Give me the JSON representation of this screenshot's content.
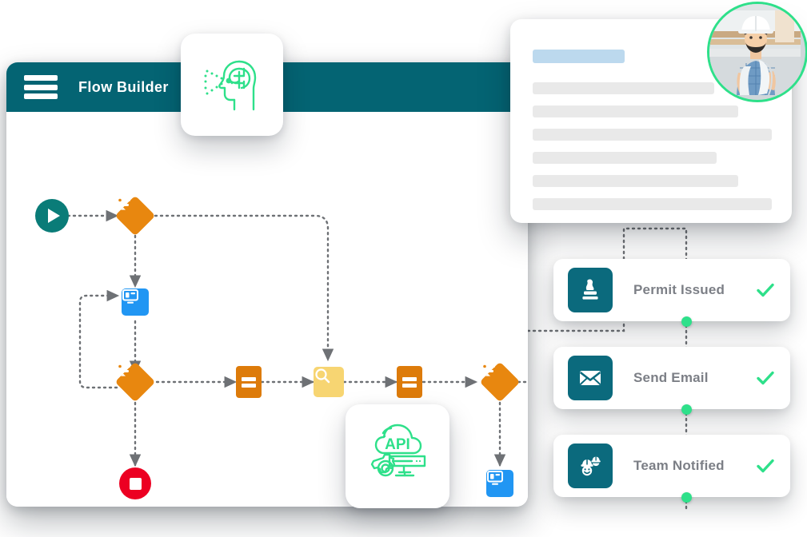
{
  "builder": {
    "title": "Flow Builder",
    "menu_icon": "hamburger-menu-icon",
    "nodes": [
      {
        "id": "start",
        "type": "start-node",
        "icon": "play-icon",
        "color": "#0a7c78"
      },
      {
        "id": "decision-1",
        "type": "decision-node",
        "icon": "filter-diamond-icon",
        "color": "#e8870f"
      },
      {
        "id": "screen-1",
        "type": "screen-node",
        "icon": "form-screen-icon",
        "color": "#2196f3"
      },
      {
        "id": "decision-2",
        "type": "decision-node",
        "icon": "filter-diamond-icon",
        "color": "#e8870f"
      },
      {
        "id": "stop",
        "type": "stop-node",
        "icon": "stop-icon",
        "color": "#ec0022"
      },
      {
        "id": "assign-1",
        "type": "assignment-node",
        "icon": "equals-icon",
        "color": "#dd7b0a"
      },
      {
        "id": "lookup",
        "type": "lookup-node",
        "icon": "search-icon",
        "color": "#f7d572"
      },
      {
        "id": "assign-2",
        "type": "assignment-node",
        "icon": "equals-icon",
        "color": "#dd7b0a"
      },
      {
        "id": "decision-3",
        "type": "decision-node",
        "icon": "filter-diamond-icon",
        "color": "#e8870f"
      },
      {
        "id": "screen-2",
        "type": "screen-node",
        "icon": "form-screen-icon",
        "color": "#2196f3"
      }
    ]
  },
  "floating_cards": [
    {
      "id": "ai-card",
      "icon": "ai-brain-head-icon",
      "color": "#2ee08a"
    },
    {
      "id": "api-card",
      "icon": "api-cloud-gear-icon",
      "color": "#2ee08a"
    }
  ],
  "document_card": {
    "skeleton_lines": [
      {
        "kind": "title",
        "width_pct": 38,
        "color": "#bcd9ee"
      },
      {
        "kind": "text",
        "width_pct": 75,
        "color": "#e9e9e9"
      },
      {
        "kind": "text",
        "width_pct": 85,
        "color": "#e9e9e9"
      },
      {
        "kind": "text",
        "width_pct": 99,
        "color": "#e9e9e9"
      },
      {
        "kind": "text",
        "width_pct": 76,
        "color": "#e9e9e9"
      },
      {
        "kind": "text",
        "width_pct": 85,
        "color": "#e9e9e9"
      },
      {
        "kind": "text",
        "width_pct": 99,
        "color": "#e9e9e9"
      }
    ]
  },
  "avatar": {
    "name": "user-avatar",
    "description": "construction worker with hard hat holding blueprints",
    "ring_color": "#2ee08a"
  },
  "status_cards": [
    {
      "label": "Permit Issued",
      "icon": "stamp-icon",
      "status_icon": "check-icon",
      "tile_color": "#0b6a7d",
      "check_color": "#2ee08a"
    },
    {
      "label": "Send Email",
      "icon": "envelope-icon",
      "status_icon": "check-icon",
      "tile_color": "#0b6a7d",
      "check_color": "#2ee08a"
    },
    {
      "label": "Team Notified",
      "icon": "hard-hat-team-icon",
      "status_icon": "check-icon",
      "tile_color": "#0b6a7d",
      "check_color": "#2ee08a"
    }
  ],
  "colors": {
    "header_teal": "#046473",
    "tile_teal": "#0b6a7d",
    "accent_green": "#2ee08a",
    "orange": "#e8870f",
    "orange_dark": "#dd7b0a",
    "yellow": "#f7d572",
    "blue": "#2196f3",
    "red": "#ec0022",
    "connector_gray": "#6e7175"
  }
}
